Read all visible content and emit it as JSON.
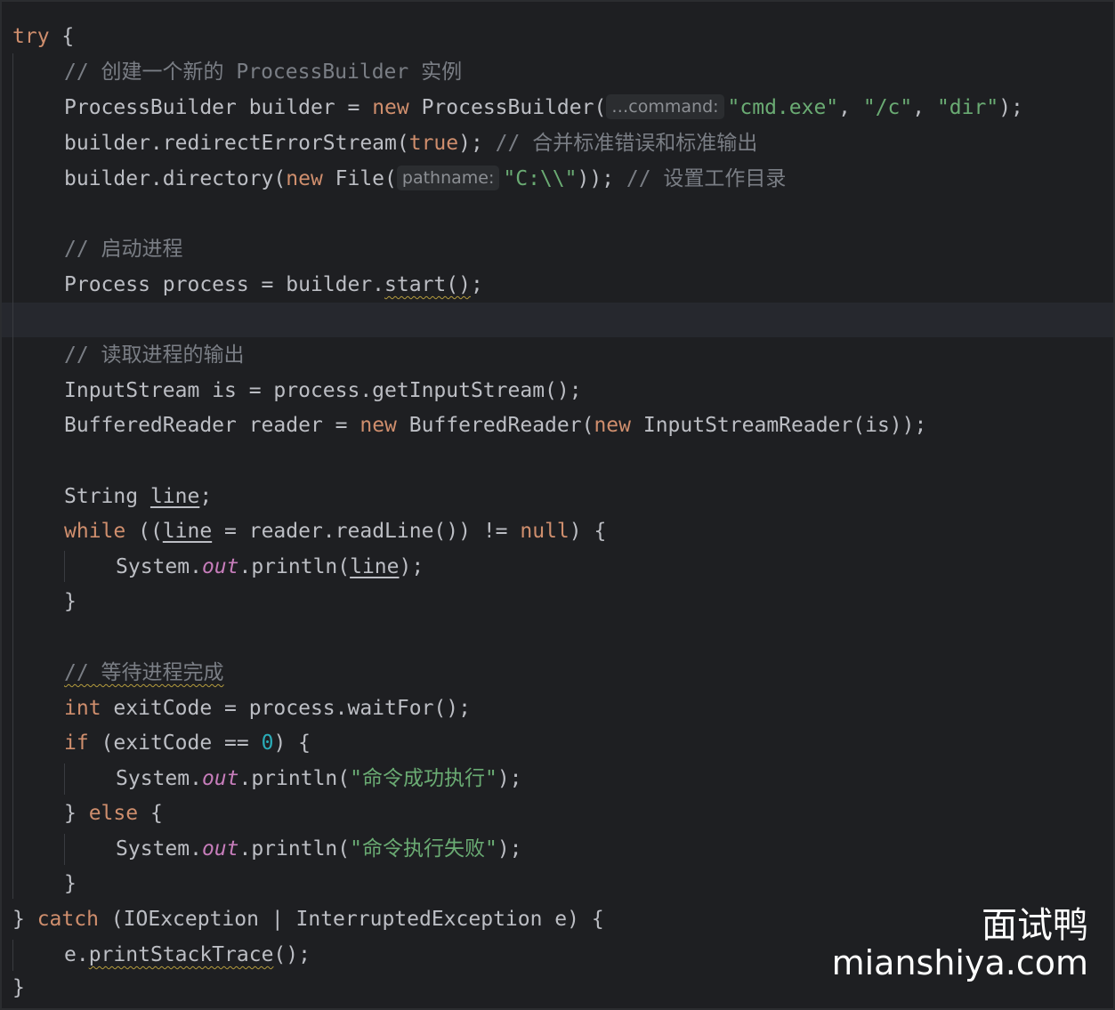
{
  "code": {
    "kw_try": "try",
    "brace_open": " {",
    "cmt_create": "// 创建一个新的 ProcessBuilder 实例",
    "pb_decl": "ProcessBuilder builder = ",
    "kw_new": "new",
    "pb_ctor": " ProcessBuilder(",
    "hint_command": "…command:",
    "str_cmd": "\"cmd.exe\"",
    "comma": ", ",
    "str_c": "\"/c\"",
    "str_dir": "\"dir\"",
    "close_paren_semi": ");",
    "redirect_pre": "builder.redirectErrorStream(",
    "kw_true": "true",
    "redirect_post": "); ",
    "cmt_merge": "// 合并标准错误和标准输出",
    "dir_pre": "builder.directory(",
    "file_ctor": " File(",
    "hint_pathname": "pathname:",
    "str_path": "\"C:\\\\\"",
    "dir_post": ")); ",
    "cmt_workdir": "// 设置工作目录",
    "cmt_start": "// 启动进程",
    "proc_pre": "Process process = builder.",
    "proc_start": "start()",
    "semi": ";",
    "cmt_read": "// 读取进程的输出",
    "is_line": "InputStream is = process.getInputStream();",
    "br_pre": "BufferedReader reader = ",
    "br_mid": " BufferedReader(",
    "isr": " InputStreamReader(is));",
    "string_decl": "String ",
    "var_line": "line",
    "kw_while": "while",
    "while_pre": " ((",
    "while_mid": " = reader.readLine()) != ",
    "kw_null": "null",
    "while_post": ") {",
    "sys": "System.",
    "field_out": "out",
    "println_open": ".println(",
    "println_line_close": ");",
    "brace_close": "}",
    "cmt_wait": "// 等待进程完成",
    "kw_int": "int",
    "exit_decl": " exitCode = process.waitFor();",
    "kw_if": "if",
    "if_pre": " (exitCode == ",
    "num_zero": "0",
    "if_post": ") {",
    "str_success": "\"命令成功执行\"",
    "close_semi": ");",
    "brace_close_sp": "} ",
    "kw_else": "else",
    "str_fail": "\"命令执行失败\"",
    "catch_close": "} ",
    "kw_catch": "catch",
    "catch_args": " (IOException | InterruptedException e) {",
    "e_pre": "e.",
    "print_stack": "printStackTrace",
    "e_post": "();"
  },
  "watermark": {
    "cn": "面试鸭",
    "en": "mianshiya.com"
  },
  "colors": {
    "background": "#1e1f22",
    "keyword": "#cf8e6d",
    "string": "#6aab73",
    "comment": "#7a7e85",
    "number": "#2aacb8",
    "static_field": "#c77dbb",
    "default_text": "#bcbec4"
  }
}
